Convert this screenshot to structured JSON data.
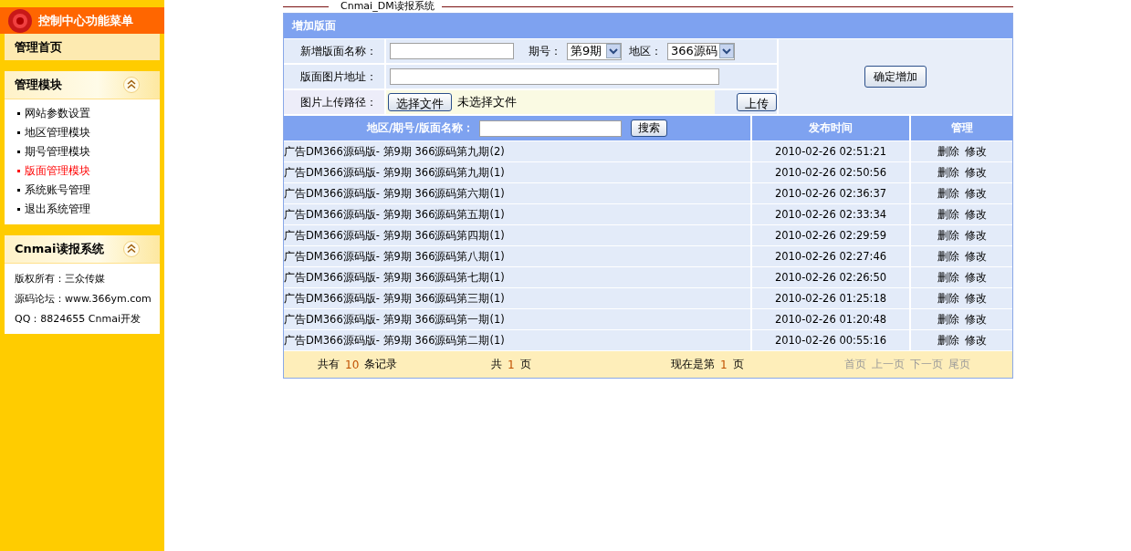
{
  "sidebar": {
    "header": "控制中心功能菜单",
    "home": "管理首页",
    "menu": {
      "title": "管理模块",
      "expanded": true,
      "items": [
        {
          "label": "网站参数设置",
          "selected": false
        },
        {
          "label": "地区管理模块",
          "selected": false
        },
        {
          "label": "期号管理模块",
          "selected": false
        },
        {
          "label": "版面管理模块",
          "selected": true
        },
        {
          "label": "系统账号管理",
          "selected": false
        },
        {
          "label": "退出系统管理",
          "selected": false
        }
      ]
    },
    "info": {
      "title": "Cnmai读报系统",
      "expanded": true,
      "lines": [
        "版权所有：三众传媒",
        "源码论坛：www.366ym.com",
        "QQ：8824655 Cnmai开发"
      ]
    }
  },
  "page_title": "Cnmai_DM读报系统",
  "form": {
    "title": "增加版面",
    "name_label": "新增版面名称：",
    "issue_label": "期号：",
    "issue_value": "第9期",
    "region_label": "地区：",
    "region_value": "366源码",
    "image_url_label": "版面图片地址：",
    "upload_label": "图片上传路径：",
    "choose_button": "选择文件",
    "file_status": "未选择文件",
    "upload_button": "上传",
    "submit_button": "确定增加"
  },
  "table": {
    "search_label": "地区/期号/版面名称：",
    "search_button": "搜索",
    "columns": [
      "发布时间",
      "管理"
    ],
    "rows": [
      {
        "name": "广告DM366源码版- 第9期 366源码第九期(2)",
        "time": "2010-02-26 02:51:21",
        "actions": [
          "删除",
          "修改"
        ]
      },
      {
        "name": "广告DM366源码版- 第9期 366源码第九期(1)",
        "time": "2010-02-26 02:50:56",
        "actions": [
          "删除",
          "修改"
        ]
      },
      {
        "name": "广告DM366源码版- 第9期 366源码第六期(1)",
        "time": "2010-02-26 02:36:37",
        "actions": [
          "删除",
          "修改"
        ]
      },
      {
        "name": "广告DM366源码版- 第9期 366源码第五期(1)",
        "time": "2010-02-26 02:33:34",
        "actions": [
          "删除",
          "修改"
        ]
      },
      {
        "name": "广告DM366源码版- 第9期 366源码第四期(1)",
        "time": "2010-02-26 02:29:59",
        "actions": [
          "删除",
          "修改"
        ]
      },
      {
        "name": "广告DM366源码版- 第9期 366源码第八期(1)",
        "time": "2010-02-26 02:27:46",
        "actions": [
          "删除",
          "修改"
        ]
      },
      {
        "name": "广告DM366源码版- 第9期 366源码第七期(1)",
        "time": "2010-02-26 02:26:50",
        "actions": [
          "删除",
          "修改"
        ]
      },
      {
        "name": "广告DM366源码版- 第9期 366源码第三期(1)",
        "time": "2010-02-26 01:25:18",
        "actions": [
          "删除",
          "修改"
        ]
      },
      {
        "name": "广告DM366源码版- 第9期 366源码第一期(1)",
        "time": "2010-02-26 01:20:48",
        "actions": [
          "删除",
          "修改"
        ]
      },
      {
        "name": "广告DM366源码版- 第9期 366源码第二期(1)",
        "time": "2010-02-26 00:55:16",
        "actions": [
          "删除",
          "修改"
        ]
      }
    ]
  },
  "pagination": {
    "total_prefix": "共有",
    "total_count": "10",
    "total_suffix": "条记录",
    "pages_prefix": "共",
    "pages_count": "1",
    "pages_suffix": "页",
    "current_prefix": "现在是第",
    "current_page": "1",
    "current_suffix": "页",
    "links": [
      {
        "label": "首页",
        "disabled": true
      },
      {
        "label": "上一页",
        "disabled": true
      },
      {
        "label": "下一页",
        "disabled": true
      },
      {
        "label": "尾页",
        "disabled": true
      }
    ]
  }
}
